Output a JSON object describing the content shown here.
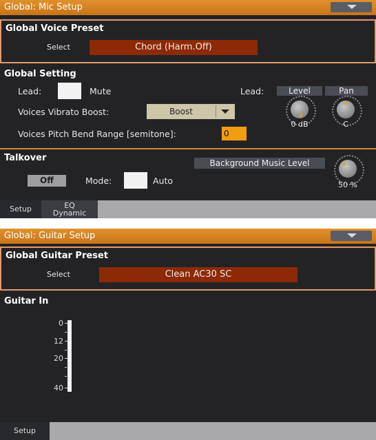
{
  "mic_setup": {
    "title": "Global: Mic Setup",
    "voice_preset": {
      "heading": "Global Voice Preset",
      "select_label": "Select",
      "select_value": "Chord (Harm.Off)"
    },
    "global_setting": {
      "heading": "Global Setting",
      "lead_label": "Lead:",
      "mute_label": "Mute",
      "mute_checked": false,
      "vibrato_label": "Voices Vibrato Boost:",
      "vibrato_value": "Boost",
      "pitch_bend_label": "Voices Pitch Bend Range [semitone]:",
      "pitch_bend_value": "0",
      "lead_right_label": "Lead:",
      "level_header": "Level",
      "pan_header": "Pan",
      "level_value": "0 dB",
      "pan_value": "C"
    },
    "talkover": {
      "heading": "Talkover",
      "toggle_label": "Off",
      "mode_label": "Mode:",
      "auto_label": "Auto",
      "auto_checked": false,
      "bg_music_header": "Background Music Level",
      "bg_music_value": "50 %"
    },
    "tabs": [
      {
        "label": "Setup",
        "active": true
      },
      {
        "label": "EQ",
        "label2": "Dynamic",
        "active": false
      }
    ]
  },
  "guitar_setup": {
    "title": "Global: Guitar Setup",
    "guitar_preset": {
      "heading": "Global Guitar Preset",
      "select_label": "Select",
      "select_value": "Clean AC30 SC"
    },
    "guitar_in": {
      "heading": "Guitar In",
      "meter_labels": [
        "0",
        "12",
        "20",
        "40"
      ]
    },
    "tabs": [
      {
        "label": "Setup",
        "active": true
      }
    ]
  },
  "colors": {
    "titlebar": "#d9822b",
    "select_field": "#8c2a06",
    "accent_field": "#f39c12",
    "panel_bg": "#232326"
  }
}
